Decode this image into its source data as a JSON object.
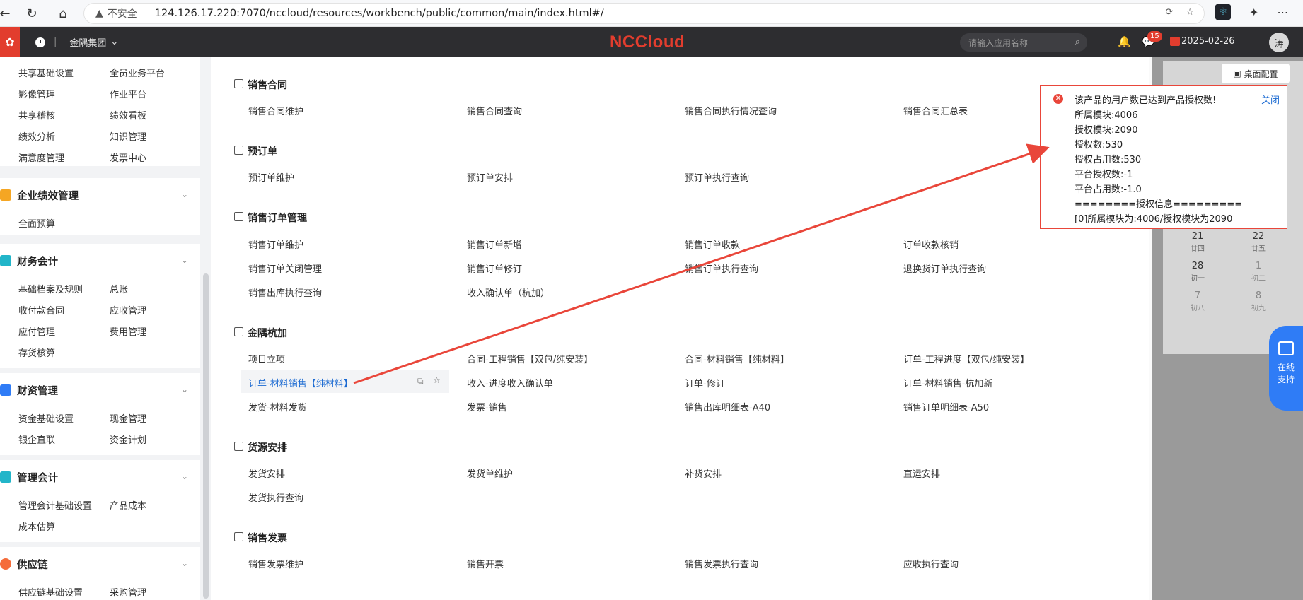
{
  "browser": {
    "url_warning": "不安全",
    "url_host": "124.126.17.220",
    "url_rest": ":7070/nccloud/resources/workbench/public/common/main/index.html#/"
  },
  "header": {
    "group": "金隅集团",
    "brand": "NCCloud",
    "search_placeholder": "请输入应用名称",
    "badge_count": "15",
    "date": "2025-02-26",
    "avatar": "涛"
  },
  "sidebar": {
    "top_links": [
      "共享基础设置",
      "全员业务平台",
      "影像管理",
      "作业平台",
      "共享稽核",
      "绩效看板",
      "绩效分析",
      "知识管理",
      "满意度管理",
      "发票中心"
    ],
    "groups": [
      {
        "title": "企业绩效管理",
        "items": [
          "全面预算"
        ]
      },
      {
        "title": "财务会计",
        "items": [
          "基础档案及规则",
          "总账",
          "收付款合同",
          "应收管理",
          "应付管理",
          "费用管理",
          "存货核算"
        ]
      },
      {
        "title": "财资管理",
        "items": [
          "资金基础设置",
          "现金管理",
          "银企直联",
          "资金计划"
        ]
      },
      {
        "title": "管理会计",
        "items": [
          "管理会计基础设置",
          "产品成本",
          "成本估算"
        ]
      },
      {
        "title": "供应链",
        "items": [
          "供应链基础设置",
          "采购管理"
        ]
      }
    ]
  },
  "main": {
    "sections": [
      {
        "title": "销售合同",
        "items": [
          "销售合同维护",
          "销售合同查询",
          "销售合同执行情况查询",
          "销售合同汇总表"
        ]
      },
      {
        "title": "预订单",
        "items": [
          "预订单维护",
          "预订单安排",
          "预订单执行查询"
        ]
      },
      {
        "title": "销售订单管理",
        "items": [
          "销售订单维护",
          "销售订单新增",
          "销售订单收款",
          "订单收款核销",
          "销售订单关闭管理",
          "销售订单修订",
          "销售订单执行查询",
          "退换货订单执行查询",
          "销售出库执行查询",
          "收入确认单（杭加）"
        ]
      },
      {
        "title": "金隅杭加",
        "items": [
          "项目立项",
          "合同-工程销售【双包/纯安装】",
          "合同-材料销售【纯材料】",
          "订单-工程进度【双包/纯安装】",
          "订单-材料销售【纯材料】",
          "收入-进度收入确认单",
          "订单-修订",
          "订单-材料销售-杭加新",
          "发货-材料发货",
          "发票-销售",
          "销售出库明细表-A40",
          "销售订单明细表-A50"
        ]
      },
      {
        "title": "货源安排",
        "items": [
          "发货安排",
          "发货单维护",
          "补货安排",
          "直运安排",
          "发货执行查询"
        ]
      },
      {
        "title": "销售发票",
        "items": [
          "销售发票维护",
          "销售开票",
          "销售发票执行查询",
          "应收执行查询"
        ]
      }
    ]
  },
  "right_panel": {
    "desk_config": "桌面配置",
    "calendar": [
      {
        "day": "21",
        "lunar": "廿四"
      },
      {
        "day": "22",
        "lunar": "廿五"
      },
      {
        "day": "28",
        "lunar": "初一"
      },
      {
        "day": "1",
        "lunar": "初二"
      },
      {
        "day": "7",
        "lunar": "初八"
      },
      {
        "day": "8",
        "lunar": "初九"
      }
    ],
    "support_line1": "在线",
    "support_line2": "支持"
  },
  "popup": {
    "close_label": "关闭",
    "lines": [
      "该产品的用户数已达到产品授权数!",
      "所属模块:4006",
      "授权模块:2090",
      "授权数:530",
      "授权占用数:530",
      "平台授权数:-1",
      "平台占用数:-1.0",
      "========授权信息=========",
      "[0]所属模块为:4006/授权模块为2090"
    ]
  },
  "colors": {
    "brand_red": "#e23d2e",
    "link_blue": "#1b6ad2",
    "annotation_arrow": "#e9463a"
  }
}
